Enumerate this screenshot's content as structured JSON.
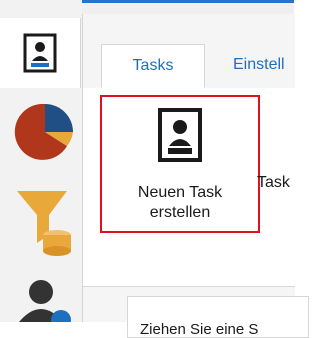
{
  "nav": {
    "items": [
      {
        "name": "tasks",
        "icon": "person-card-icon",
        "active": true
      },
      {
        "name": "statistics",
        "icon": "pie-chart-icon"
      },
      {
        "name": "filter",
        "icon": "filter-database-icon"
      },
      {
        "name": "users",
        "icon": "user-info-icon"
      }
    ]
  },
  "tabs": {
    "active_label": "Tasks",
    "other_label": "Einstell"
  },
  "ribbon": {
    "new_task_line1": "Neuen Task",
    "new_task_line2": "erstellen",
    "side_label": "Task"
  },
  "hint": {
    "text": "Ziehen Sie eine S"
  },
  "colors": {
    "accent": "#2a72c7",
    "highlight_border": "#e0101f",
    "tab_text": "#1e6fbf"
  }
}
